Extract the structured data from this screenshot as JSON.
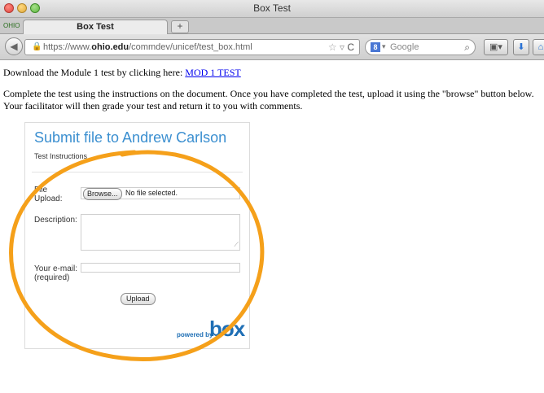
{
  "window": {
    "title": "Box Test"
  },
  "tab": {
    "label": "Box Test",
    "favicon_text": "OHIO"
  },
  "newtab_label": "+",
  "navbar": {
    "url_prefix": "https://www.",
    "url_domain": "ohio.edu",
    "url_path": "/commdev/unicef/test_box.html",
    "search_engine_icon": "g-search-icon",
    "search_placeholder": "Google"
  },
  "content": {
    "download_text": "Download the Module 1 test by clicking here: ",
    "download_link": "MOD 1 TEST",
    "instructions_line1": "Complete the test using the instructions on the document. Once you have completed the test, upload it using the \"browse\" button below.",
    "instructions_line2": "Your facilitator will then grade your test and return it to you with comments."
  },
  "upload_box": {
    "title": "Submit file to Andrew Carlson",
    "subtitle": "Test Instructions",
    "file_label_1": "File",
    "file_label_2": "Upload:",
    "browse_label": "Browse...",
    "no_file_text": "No file selected.",
    "description_label": "Description:",
    "email_label_1": "Your e-mail:",
    "email_label_2": "(required)",
    "upload_label": "Upload",
    "powered_by": "powered by",
    "logo_text": "box"
  },
  "colors": {
    "annotation": "#f5a01a",
    "box_title": "#3b8fd0",
    "link": "#0000ee"
  }
}
